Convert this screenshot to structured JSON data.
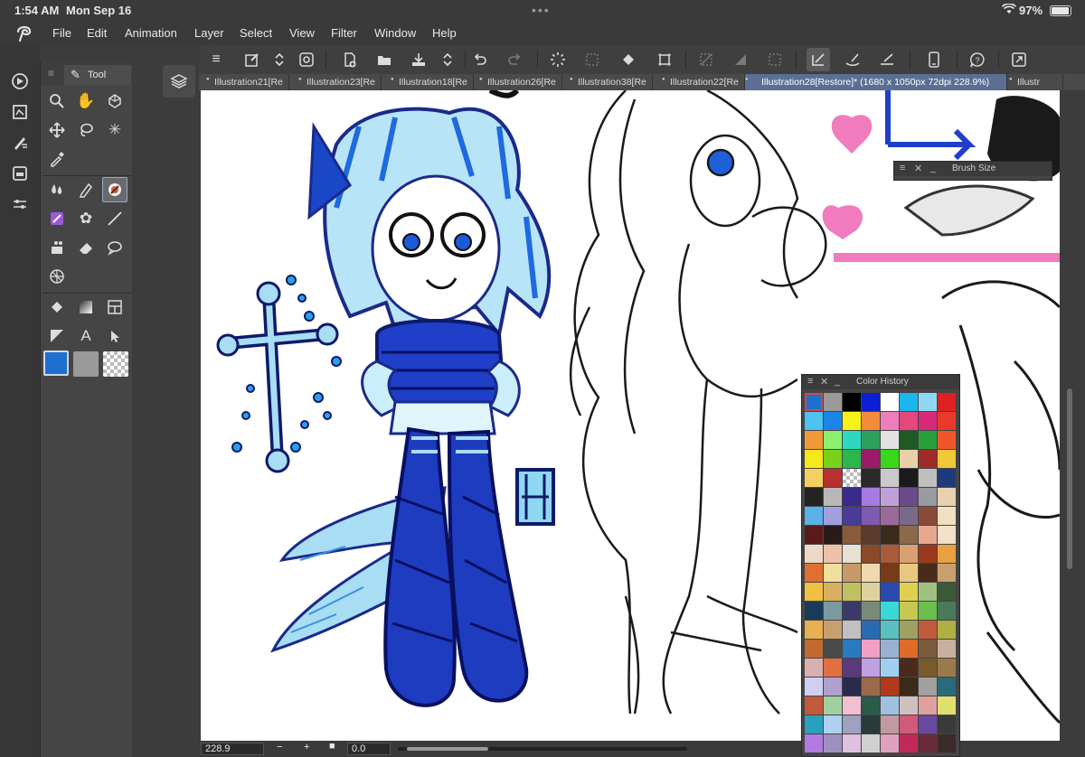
{
  "status": {
    "time": "1:54 AM",
    "date": "Mon Sep 16",
    "battery": "97%"
  },
  "menu": [
    "File",
    "Edit",
    "Animation",
    "Layer",
    "Select",
    "View",
    "Filter",
    "Window",
    "Help"
  ],
  "tool_panel": {
    "tab_label": "Tool",
    "main_color": "#1f6fcf",
    "sub_color": "#9a9a9a"
  },
  "tabs": [
    {
      "label": "Illustration21[Re",
      "active": false
    },
    {
      "label": "Illustration23[Re",
      "active": false
    },
    {
      "label": "Illustration18[Re",
      "active": false
    },
    {
      "label": "Illustration26[Re",
      "active": false
    },
    {
      "label": "Illustration38[Re",
      "active": false
    },
    {
      "label": "Illustration22[Re",
      "active": false
    },
    {
      "label": "Illustration28[Restore]* (1680 x 1050px 72dpi 228.9%)",
      "active": true
    },
    {
      "label": "Illustr",
      "active": false
    }
  ],
  "bottom": {
    "zoom": "228.9",
    "rotation": "0.0"
  },
  "brush_size_panel": {
    "title": "Brush Size"
  },
  "color_history": {
    "title": "Color History",
    "colors": [
      "#1f6fcf",
      "#9a9a9a",
      "#000000",
      "#0a1fd6",
      "#ffffff",
      "#1bb5f0",
      "#8fd8f2",
      "#e02020",
      "#4cc3f0",
      "#1b86e8",
      "#f7f21a",
      "#f48b3a",
      "#f07bbd",
      "#e2487a",
      "#d8287a",
      "#e83a2a",
      "#f09a3a",
      "#8ef070",
      "#2ed8c0",
      "#2aa05a",
      "#e2e2e2",
      "#1d5a24",
      "#27a13a",
      "#f0562a",
      "#f7e81a",
      "#7ad01a",
      "#2ab84a",
      "#9b1a6a",
      "#3ad81a",
      "#ead0a8",
      "#a02a2a",
      "#f0c838",
      "#f3d060",
      "#b83030",
      "#checker",
      "#2a2a2a",
      "#c9c9c9",
      "#1a1a1a",
      "#bfbfbf",
      "#1f3a7a",
      "#232323",
      "#b8b8b8",
      "#3a2a8a",
      "#a67ae0",
      "#c0a0d8",
      "#6a4a8a",
      "#9a9aa0",
      "#e8d0b0",
      "#5ab0e8",
      "#a0a0e0",
      "#4a3a9a",
      "#7e5ab0",
      "#9a6a9a",
      "#7a6a8a",
      "#8a4a3a",
      "#f0e0c0",
      "#5a1a1a",
      "#2a1a1a",
      "#8a5a3a",
      "#5a3a2a",
      "#3a2a1a",
      "#8a6a4a",
      "#e8a890",
      "#f2e0c8",
      "#f0d8c8",
      "#f0c0a8",
      "#e8e0d0",
      "#8a4a2a",
      "#a85a3a",
      "#d8a070",
      "#9a3a1a",
      "#e8a040",
      "#e07030",
      "#f0e0a0",
      "#c89a6a",
      "#f0d8b0",
      "#7a3a1a",
      "#e8c880",
      "#4a2a1a",
      "#c8a070",
      "#f0c040",
      "#d8b060",
      "#c0c060",
      "#e0d0a0",
      "#2a4ab0",
      "#e0d050",
      "#a0c080",
      "#3a5a3a",
      "#1a3a5a",
      "#7a9aa0",
      "#3a3a6a",
      "#7a8a7a",
      "#3ad8d8",
      "#c8c850",
      "#6ac04a",
      "#4a7a5a",
      "#e8b050",
      "#c8a070",
      "#c0c0c0",
      "#2a6ab0",
      "#5ac0c0",
      "#a0a060",
      "#c05a3a",
      "#b0b040",
      "#c06a30",
      "#4a4a4a",
      "#2a7ac0",
      "#f0a0c0",
      "#9ab0d0",
      "#e06a2a",
      "#7a5a3a",
      "#c8b0a0",
      "#d8b0b0",
      "#e07040",
      "#5a3a7a",
      "#c0a0e0",
      "#a0d0f0",
      "#4a2a1a",
      "#7a5a2a",
      "#9a7a4a",
      "#d0d0f0",
      "#b0a0d0",
      "#2a2a4a",
      "#9a6a4a",
      "#b03a1a",
      "#3a2a1a",
      "#a0a0a0",
      "#2a6a7a",
      "#c05a3a",
      "#a0d0a0",
      "#f0c0d0",
      "#2a5a4a",
      "#a0c0e0",
      "#d0c0c0",
      "#e0a0a0",
      "#e0e070",
      "#2aa0c0",
      "#b0d0f0",
      "#a0a0c0",
      "#2a3a3a",
      "#c09aa0",
      "#d05a7a",
      "#6a4aa0",
      "#3a3a3a",
      "#b07ae0",
      "#a090c0",
      "#e0c0e0",
      "#d0d0d0",
      "#e0a0c0",
      "#c02a5a",
      "#6a2a3a",
      "#3a2a2a"
    ]
  }
}
